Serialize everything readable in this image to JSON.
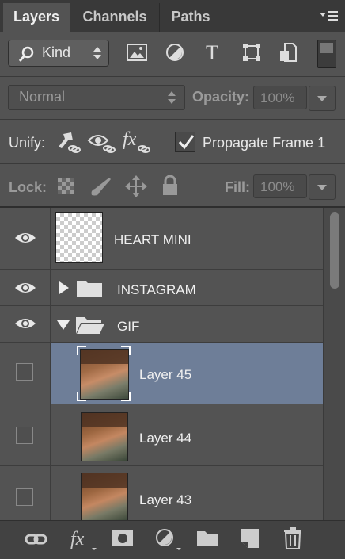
{
  "tabs": [
    {
      "label": "Layers",
      "active": true
    },
    {
      "label": "Channels",
      "active": false
    },
    {
      "label": "Paths",
      "active": false
    }
  ],
  "filter": {
    "kind_label": "Kind",
    "icons": [
      "image-filter-icon",
      "adjustment-filter-icon",
      "type-filter-icon",
      "shape-filter-icon",
      "smart-object-filter-icon",
      "filter-toggle-icon"
    ]
  },
  "blend": {
    "mode": "Normal",
    "opacity_label": "Opacity:",
    "opacity_value": "100%"
  },
  "unify": {
    "label": "Unify:",
    "propagate_label": "Propagate Frame 1",
    "propagate_checked": true
  },
  "lock": {
    "label": "Lock:",
    "fill_label": "Fill:",
    "fill_value": "100%"
  },
  "layers": [
    {
      "name": "HEART MINI",
      "type": "layer",
      "visible": true
    },
    {
      "name": "INSTAGRAM",
      "type": "group-collapsed",
      "visible": true
    },
    {
      "name": "GIF",
      "type": "group-expanded",
      "visible": true
    },
    {
      "name": "Layer 45",
      "type": "frame-layer",
      "visible": false,
      "selected": true
    },
    {
      "name": "Layer 44",
      "type": "frame-layer",
      "visible": false
    },
    {
      "name": "Layer 43",
      "type": "frame-layer",
      "visible": false
    }
  ],
  "bottom_icons": [
    "link-layers-icon",
    "fx-icon",
    "mask-icon",
    "adjustment-icon",
    "new-group-icon",
    "new-layer-icon",
    "trash-icon"
  ],
  "colors": {
    "panel": "#535353",
    "selection": "#6e7e98",
    "tabbar": "#393939"
  }
}
